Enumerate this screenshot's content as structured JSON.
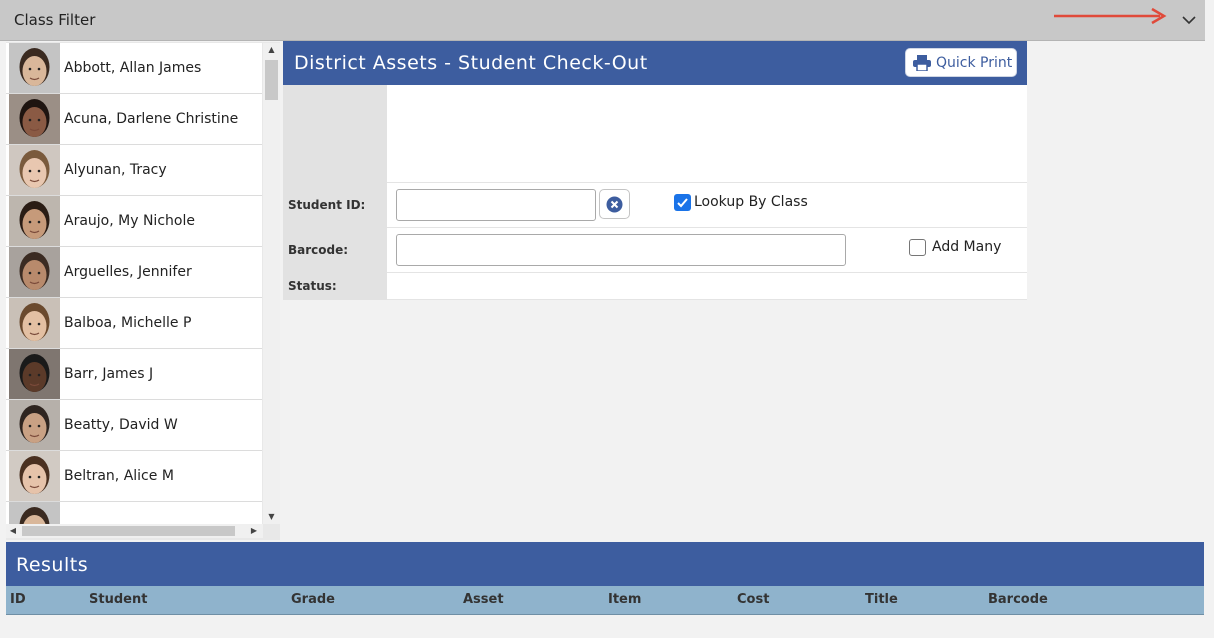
{
  "class_filter": {
    "title": "Class Filter"
  },
  "students": [
    {
      "name": "Abbott, Allan James"
    },
    {
      "name": "Acuna, Darlene Christine"
    },
    {
      "name": "Alyunan, Tracy"
    },
    {
      "name": "Araujo, My Nichole"
    },
    {
      "name": "Arguelles, Jennifer"
    },
    {
      "name": "Balboa, Michelle P"
    },
    {
      "name": "Barr, James J"
    },
    {
      "name": "Beatty, David W"
    },
    {
      "name": "Beltran, Alice M"
    }
  ],
  "checkout": {
    "title": "District Assets - Student Check-Out",
    "quick_print": "Quick Print",
    "student_id_label": "Student ID:",
    "student_id_value": "",
    "barcode_label": "Barcode:",
    "barcode_value": "",
    "status_label": "Status:",
    "lookup_by_class_label": "Lookup By Class",
    "lookup_by_class_checked": true,
    "add_many_label": "Add Many",
    "add_many_checked": false
  },
  "results": {
    "title": "Results",
    "columns": [
      "ID",
      "Student",
      "Grade",
      "Asset",
      "Item",
      "Cost",
      "Title",
      "Barcode"
    ]
  },
  "colors": {
    "header_blue": "#3d5d9f",
    "columns_bar": "#8fb3cc",
    "filter_bar": "#c8c8c8",
    "arrow": "#e04a3a",
    "checkbox_checked": "#1a73e8"
  },
  "icons": {
    "filter_toggle": "chevron-down-icon",
    "annotation": "red-arrow-icon",
    "print": "printer-icon",
    "clear": "clear-x-circle-icon"
  }
}
